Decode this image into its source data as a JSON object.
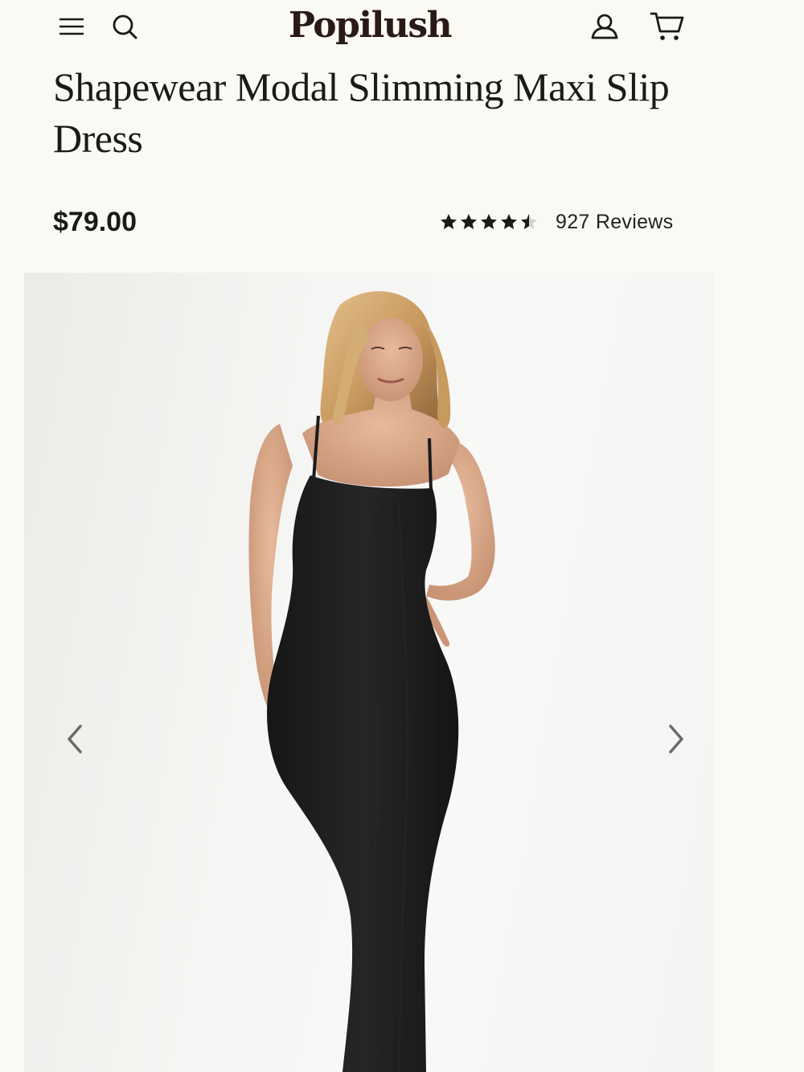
{
  "header": {
    "logo": "Popilush",
    "icons": {
      "menu": "menu-icon",
      "search": "search-icon",
      "account": "user-icon",
      "cart": "cart-icon"
    }
  },
  "product": {
    "title": "Shapewear Modal Slimming Maxi Slip Dress",
    "price": "$79.00",
    "rating": {
      "value_stars": 4.5,
      "max_stars": 5,
      "reviews_label": "927 Reviews"
    }
  },
  "gallery": {
    "image": "model-in-black-maxi-slip-dress",
    "prev_icon": "chevron-left-icon",
    "next_icon": "chevron-right-icon"
  },
  "colors": {
    "background": "#faf9f3",
    "text": "#1a1a1a",
    "logo": "#2a1a14",
    "dress": "#1b1b1b",
    "arrow": "#6b6b6b"
  }
}
